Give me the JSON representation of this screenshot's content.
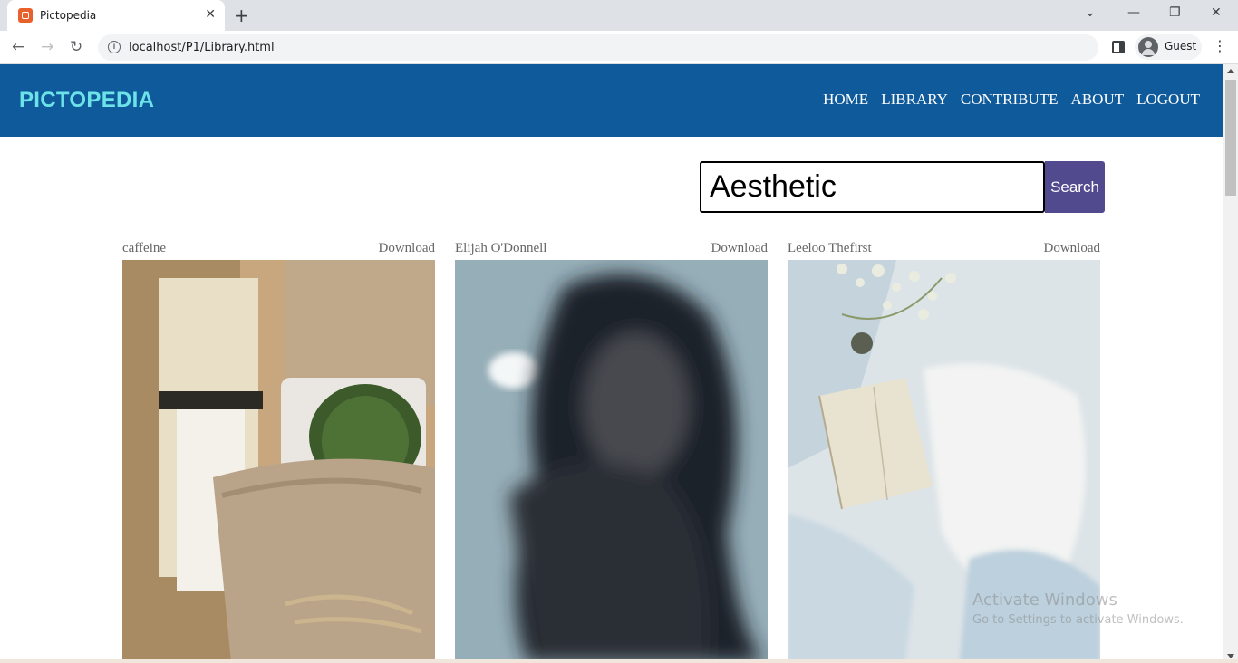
{
  "browser": {
    "tab_title": "Pictopedia",
    "url": "localhost/P1/Library.html",
    "profile_name": "Guest"
  },
  "site": {
    "brand": "PICTOPEDIA",
    "nav": [
      "HOME",
      "LIBRARY",
      "CONTRIBUTE",
      "ABOUT",
      "LOGOUT"
    ]
  },
  "search": {
    "value": "Aesthetic",
    "button_label": "Search"
  },
  "cards": [
    {
      "author": "caffeine",
      "download_label": "Download",
      "image": "cactus-in-paper-pot"
    },
    {
      "author": "Elijah O'Donnell",
      "download_label": "Download",
      "image": "blurred-portrait"
    },
    {
      "author": "Leeloo Thefirst",
      "download_label": "Download",
      "image": "book-on-linen-with-flowers"
    }
  ],
  "watermark": {
    "title": "Activate Windows",
    "subtitle": "Go to Settings to activate Windows."
  }
}
